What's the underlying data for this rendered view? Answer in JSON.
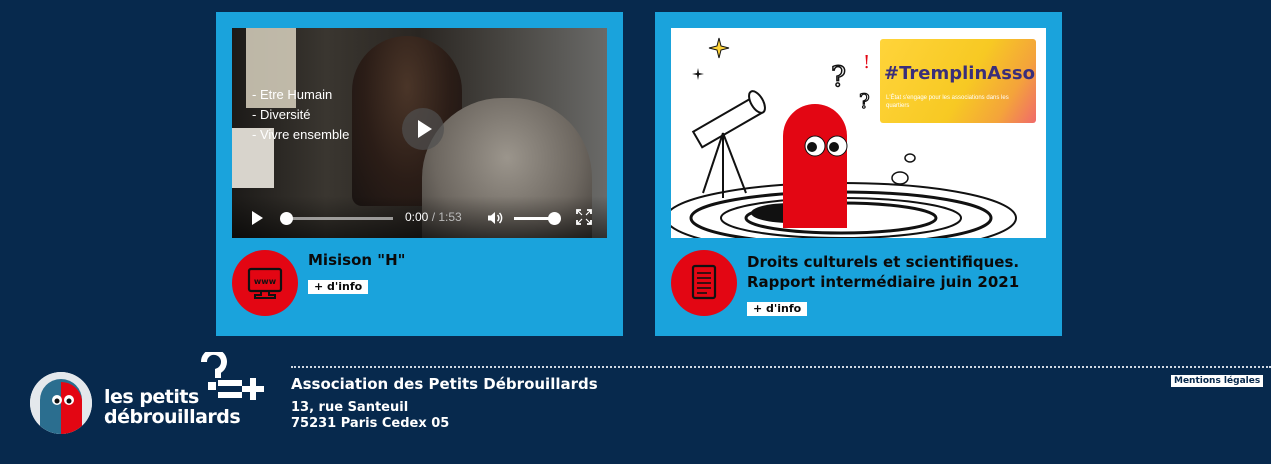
{
  "cards": [
    {
      "video": {
        "overlay_lines": [
          "- Etre Humain",
          "- Diversité",
          "- Vivre ensemble"
        ],
        "time_current": "0:00",
        "time_sep": " / ",
        "time_duration": "1:53",
        "volume": 1.0,
        "progress": 0.0
      },
      "icon": "www-monitor-icon",
      "title": "Misison \"H\"",
      "info_label": "+ d'info"
    },
    {
      "illustration": {
        "badge_title": "#TremplinAsso",
        "badge_subtitle": "L'État s'engage pour les associations dans les quartiers"
      },
      "icon": "document-icon",
      "title_lines": [
        "Droits culturels et scientifiques.",
        "Rapport intermédiaire juin 2021"
      ],
      "info_label": "+ d'info"
    }
  ],
  "footer": {
    "logo_line1": "les petits",
    "logo_line2": "débrouillards",
    "association_name": "Association des Petits Débrouillards",
    "address_line1": "13, rue Santeuil",
    "address_line2": "75231 Paris Cedex 05",
    "mentions_label": "Mentions légales"
  },
  "colors": {
    "page_bg": "#07294d",
    "card_bg": "#1aa3dc",
    "accent_red": "#e30613",
    "badge_purple": "#3a2e7a"
  }
}
